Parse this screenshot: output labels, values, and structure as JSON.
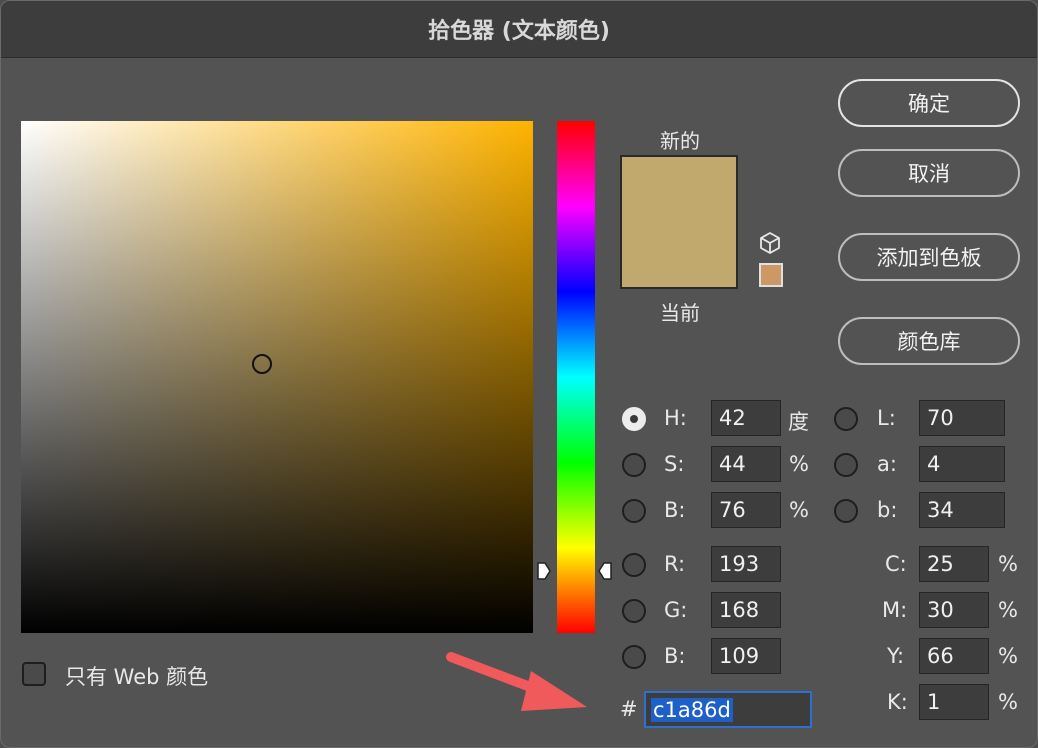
{
  "window": {
    "title": "拾色器 (文本颜色)"
  },
  "buttons": {
    "ok": "确定",
    "cancel": "取消",
    "add_to_swatches": "添加到色板",
    "color_libraries": "颜色库"
  },
  "preview": {
    "new_label": "新的",
    "current_label": "当前",
    "new_color": "#c1a86d",
    "current_color": "#c1a86d",
    "web_safe_color": "#cc9966"
  },
  "hsb": {
    "h": {
      "label": "H:",
      "value": "42",
      "unit": "度",
      "selected": true
    },
    "s": {
      "label": "S:",
      "value": "44",
      "unit": "%"
    },
    "b": {
      "label": "B:",
      "value": "76",
      "unit": "%"
    }
  },
  "lab": {
    "l": {
      "label": "L:",
      "value": "70"
    },
    "a": {
      "label": "a:",
      "value": "4"
    },
    "b": {
      "label": "b:",
      "value": "34"
    }
  },
  "rgb": {
    "r": {
      "label": "R:",
      "value": "193"
    },
    "g": {
      "label": "G:",
      "value": "168"
    },
    "b": {
      "label": "B:",
      "value": "109"
    }
  },
  "cmyk": {
    "c": {
      "label": "C:",
      "value": "25",
      "unit": "%"
    },
    "m": {
      "label": "M:",
      "value": "30",
      "unit": "%"
    },
    "y": {
      "label": "Y:",
      "value": "66",
      "unit": "%"
    },
    "k": {
      "label": "K:",
      "value": "1",
      "unit": "%"
    }
  },
  "hex": {
    "label": "#",
    "value": "c1a86d"
  },
  "web_only": {
    "label": "只有 Web 颜色",
    "checked": false
  },
  "colors": {
    "hue_base": "#ffb300",
    "hex_highlight": "#1f5fc8",
    "annotation_arrow": "#f15a5a"
  }
}
